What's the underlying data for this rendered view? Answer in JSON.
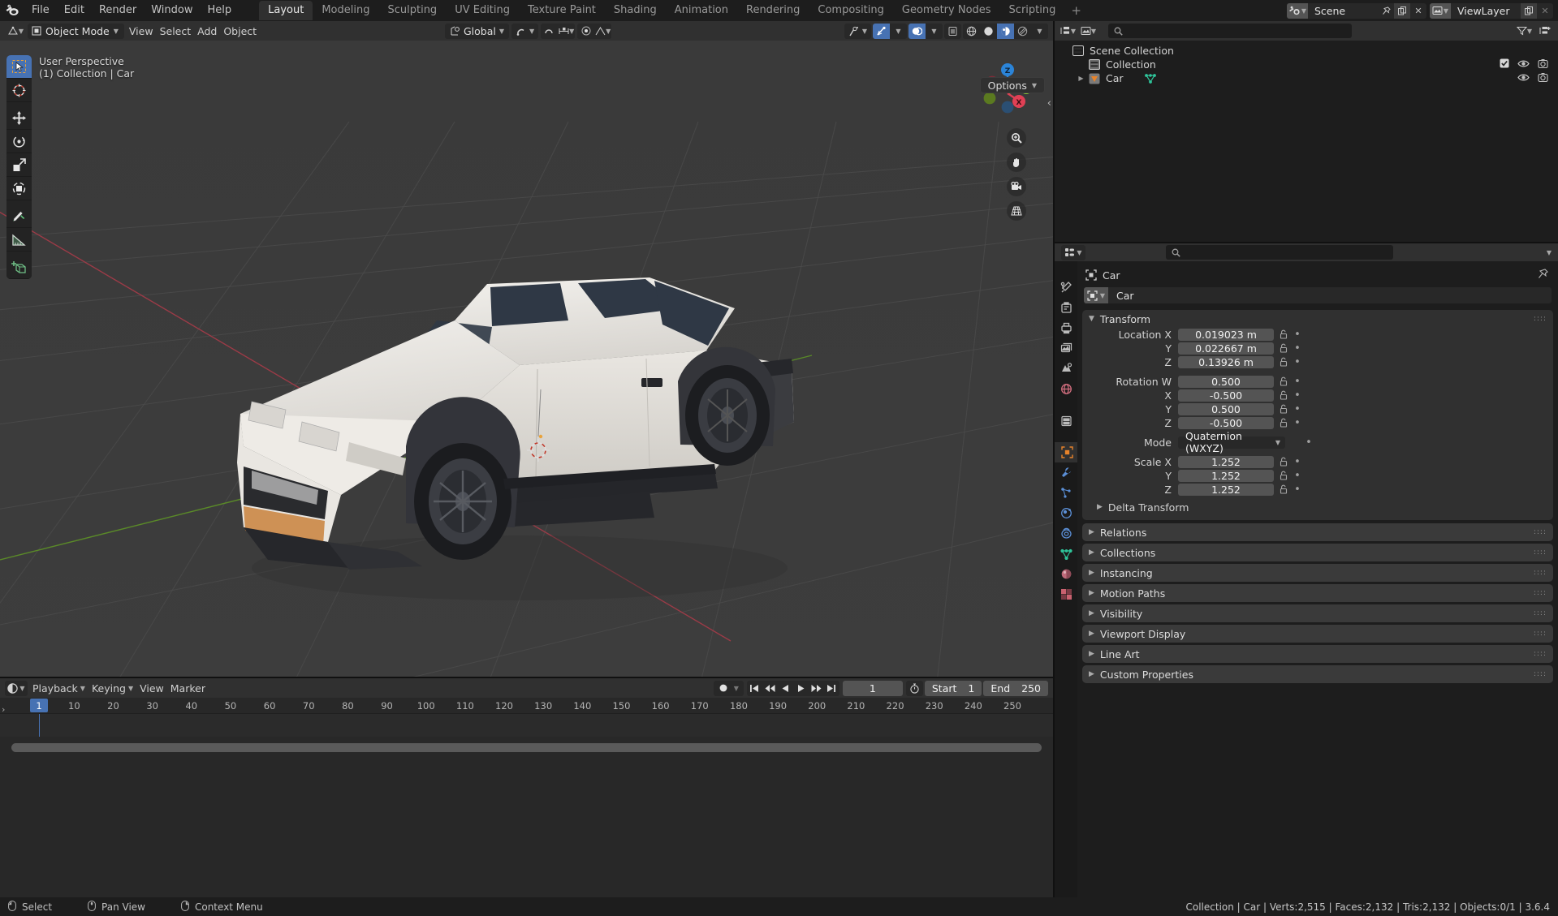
{
  "topbar": {
    "menus": [
      "File",
      "Edit",
      "Render",
      "Window",
      "Help"
    ],
    "workspaces": [
      "Layout",
      "Modeling",
      "Sculpting",
      "UV Editing",
      "Texture Paint",
      "Shading",
      "Animation",
      "Rendering",
      "Compositing",
      "Geometry Nodes",
      "Scripting"
    ],
    "active_workspace": "Layout",
    "add_workspace": "+",
    "scene_name": "Scene",
    "viewlayer_name": "ViewLayer"
  },
  "viewport_header": {
    "mode": "Object Mode",
    "menus": [
      "View",
      "Select",
      "Add",
      "Object"
    ],
    "transform_orientation": "Global",
    "options_label": "Options"
  },
  "viewport": {
    "perspective_label": "User Perspective",
    "collection_label": "(1) Collection | Car",
    "gizmo_axes": [
      "X",
      "Y",
      "Z"
    ],
    "gizmo_colors": {
      "x": "#e04055",
      "y": "#8bc832",
      "z": "#2b84d8"
    },
    "tools": [
      "tweak-select-tool",
      "cursor-tool",
      "move-tool",
      "rotate-tool",
      "scale-tool",
      "transform-tool",
      "annotate-tool",
      "measure-tool",
      "add-cube-tool"
    ],
    "nav_buttons": [
      "zoom-icon",
      "hand-pan-icon",
      "camera-icon",
      "grid-perspective-icon"
    ]
  },
  "outliner": {
    "search_placeholder": "",
    "rows": [
      {
        "label": "Scene Collection",
        "icon": "collection-icon",
        "indent": 0,
        "has_tri": false,
        "checkbox": false,
        "eye": false,
        "camera": false
      },
      {
        "label": "Collection",
        "icon": "collection-icon",
        "indent": 1,
        "has_tri": false,
        "checkbox": true,
        "eye": true,
        "camera": true
      },
      {
        "label": "Car",
        "icon": "object-icon",
        "indent": 1,
        "has_tri": true,
        "checkbox": false,
        "eye": true,
        "camera": true,
        "mesh_icon": true
      }
    ]
  },
  "properties": {
    "breadcrumb_object": "Car",
    "object_name": "Car",
    "transform_panel_title": "Transform",
    "fields": [
      {
        "label": "Location X",
        "value": "0.019023 m"
      },
      {
        "label": "Y",
        "value": "0.022667 m"
      },
      {
        "label": "Z",
        "value": "0.13926 m"
      },
      {
        "label": "Rotation W",
        "value": "0.500",
        "gap_before": true
      },
      {
        "label": "X",
        "value": "-0.500"
      },
      {
        "label": "Y",
        "value": "0.500"
      },
      {
        "label": "Z",
        "value": "-0.500"
      },
      {
        "label": "Mode",
        "value": "Quaternion (WXYZ)",
        "dropdown": true,
        "gap_before": true
      },
      {
        "label": "Scale X",
        "value": "1.252",
        "gap_before": true
      },
      {
        "label": "Y",
        "value": "1.252"
      },
      {
        "label": "Z",
        "value": "1.252"
      }
    ],
    "delta_transform_label": "Delta Transform",
    "closed_panels": [
      "Relations",
      "Collections",
      "Instancing",
      "Motion Paths",
      "Visibility",
      "Viewport Display",
      "Line Art",
      "Custom Properties"
    ],
    "tabs": [
      "tool-tab",
      "render-tab",
      "output-tab",
      "view-layer-tab",
      "scene-tab",
      "world-tab",
      "collection-tab",
      "object-tab",
      "modifiers-tab",
      "particles-tab",
      "physics-tab",
      "constraints-tab",
      "data-tab",
      "material-tab",
      "texture-tab"
    ],
    "active_tab": "object-tab"
  },
  "timeline": {
    "menus": [
      "Playback",
      "Keying",
      "View",
      "Marker"
    ],
    "current_frame": "1",
    "start_label": "Start",
    "start_value": "1",
    "end_label": "End",
    "end_value": "250",
    "ticks": [
      10,
      20,
      30,
      40,
      50,
      60,
      70,
      80,
      90,
      100,
      110,
      120,
      130,
      140,
      150,
      160,
      170,
      180,
      190,
      200,
      210,
      220,
      230,
      240,
      250
    ],
    "playhead_frame": 1
  },
  "statusbar": {
    "items": [
      {
        "icon": "mouse-left-icon",
        "label": "Select"
      },
      {
        "icon": "mouse-middle-icon",
        "label": "Pan View"
      },
      {
        "icon": "mouse-right-icon",
        "label": "Context Menu"
      }
    ],
    "stats": "Collection | Car | Verts:2,515 | Faces:2,132 | Tris:2,132 | Objects:0/1 | 3.6.4"
  },
  "colors": {
    "accent_blue": "#4772b3",
    "accent_orange": "#e87d0d",
    "panel_bg": "#303030",
    "window_bg": "#1d1d1d",
    "viewport_bg": "#3b3b3b"
  }
}
